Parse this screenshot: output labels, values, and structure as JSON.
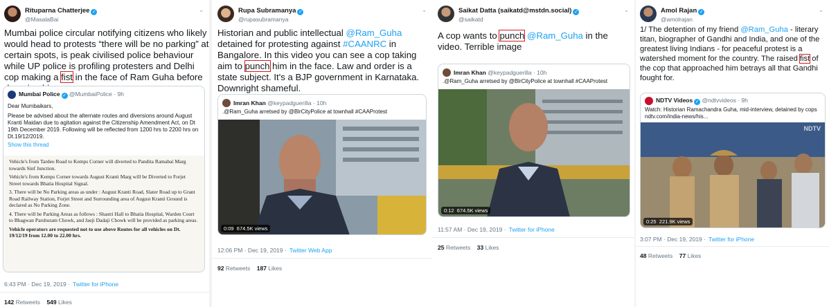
{
  "tweets": [
    {
      "author": "Rituparna Chatterjee",
      "handle": "@MasalaBai",
      "text_parts": [
        "Mumbai police circular notifying citizens who likely would head to protests “there will be no parking” at certain spots, is peak civilised police behaviour while UP police is profiling protesters and Delhi cop making a ",
        "fist",
        " in the face of Ram Guha before dragging him away."
      ],
      "quote": {
        "author": "Mumbai Police",
        "handle": "@MumbaiPolice",
        "time": "9h",
        "text": "Dear Mumbaikars,",
        "text2": "Please be advised about the alternate routes and diversions around August Kranti Maidan due to agitation against the Citizenship Amendment Act, on Dt 19th December 2019. Following will be reflected from 1200 hrs to 2200 hrs on Dt.19/12/2019.",
        "link": "Show this thread",
        "doc_lines": [
          "Vehicle's from Tardeo Road to Kemps Corner will diverted to Pandita Ramabai Marg towards Sinf Junction.",
          "Vehicle's from Kemps Corner towards August Kranti Marg will be Diverted to Forjet Street towards Bhatia Hospital Signal.",
          "3. There will be No Parking areas as under : August Kranti Road, Slater Road up to Grant Road Railway Station, Forjet Street and Surrounding area of August Kranti Ground is declared as No Parking Zone.",
          "4. There will be Parking Areas as follows : Shastri Hall to Bhatia Hospital, Warden Court to Bhagwan Parshuram Chowk, and Jaeji Dadaji Chowk will be provided as parking areas.",
          "Vehicle operators are requested not to use above Routes for all vehicles on Dt. 19/12/19 from 12.00 to 22.00 hrs."
        ]
      },
      "meta_time": "6:43 PM · Dec 19, 2019 ·",
      "meta_source": "Twitter for iPhone",
      "retweets": "142",
      "retweets_label": "Retweets",
      "likes": "549",
      "likes_label": "Likes"
    },
    {
      "author": "Rupa Subramanya",
      "handle": "@rupasubramanya",
      "text_parts": [
        "Historian and public intellectual ",
        "@Ram_Guha",
        " detained for protesting against ",
        "#CAANRC",
        " in Bangalore. In this video you can see a cop taking aim to ",
        "punch",
        " him in the face. Law and order is a state subject. It's a BJP government in Karnataka. Downright shameful."
      ],
      "quote": {
        "author": "Imran Khan",
        "handle": "@keypadguerilla",
        "time": "10h",
        "text": ".@Ram_Guha arretsed by @BlrCityPolice at townhall #CAAProtest",
        "video_time": "0:09",
        "views": "674.5K views"
      },
      "meta_time": "12:06 PM · Dec 19, 2019 ·",
      "meta_source": "Twitter Web App",
      "retweets": "92",
      "retweets_label": "Retweets",
      "likes": "187",
      "likes_label": "Likes"
    },
    {
      "author": "Saikat Datta (saikatd@mstdn.social)",
      "handle": "@saikatd",
      "text_parts": [
        "A cop wants to ",
        "punch",
        " ",
        "@Ram_Guha",
        "  in the video. Terrible image"
      ],
      "quote": {
        "author": "Imran Khan",
        "handle": "@keypadguerilla",
        "time": "10h",
        "text": ".@Ram_Guha arretsed by @BlrCityPolice at townhall #CAAProtest",
        "video_time": "0:12",
        "views": "674.5K views"
      },
      "meta_time": "11:57 AM · Dec 19, 2019 ·",
      "meta_source": "Twitter for iPhone",
      "retweets": "25",
      "retweets_label": "Retweets",
      "likes": "33",
      "likes_label": "Likes"
    },
    {
      "author": "Amol Rajan",
      "handle": "@amolrajan",
      "text_parts": [
        "1/ The detention of my friend ",
        "@Ram_Guha",
        " - literary titan, biographer of Gandhi and India, and one of the greatest living Indians - for peaceful protest is a watershed moment for the country. The raised ",
        "fist",
        " of the cop that approached him betrays all that Gandhi fought for."
      ],
      "quote": {
        "author": "NDTV Videos",
        "handle": "@ndtvvideos",
        "time": "9h",
        "text": "Watch: Historian Ramachandra Guha, mid-interview, detained by cops ndtv.com/india-news/his...",
        "video_time": "0:25",
        "views": "221.9K views",
        "watermark": "NDTV"
      },
      "meta_time": "3:07 PM · Dec 19, 2019 ·",
      "meta_source": "Twitter for iPhone",
      "retweets": "48",
      "retweets_label": "Retweets",
      "likes": "77",
      "likes_label": "Likes"
    }
  ],
  "colors": {
    "link": "#1da1f2",
    "highlight": "#d41d1d",
    "muted": "#657786"
  }
}
